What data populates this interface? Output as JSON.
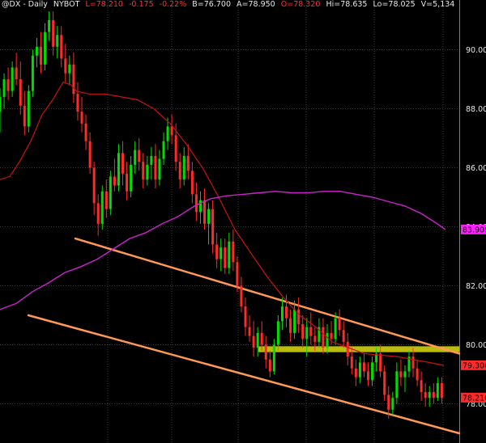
{
  "header": {
    "symbol": "@DX - Daily",
    "exchange": "NYBOT",
    "last": "L=78.210",
    "change": "-0.175",
    "change_pct": "-0.22%",
    "bid": "B=76.700",
    "ask": "A=78.950",
    "open": "O=78.320",
    "high": "Hi=78.635",
    "low": "Lo=78.025",
    "volume": "V=5,134"
  },
  "colors": {
    "background": "#000000",
    "grid": "#3a3a3a",
    "up_candle": "#00dd00",
    "down_candle": "#ff2a2a",
    "ma_short": "#cc1111",
    "ma_long": "#cc22cc",
    "channel": "#ff9955",
    "zone": "#dddd11",
    "header_red": "#ff3030",
    "tag_magenta": "#ff22ff",
    "tag_red": "#ff2a2a"
  },
  "chart_data": {
    "type": "candlestick",
    "title": "@DX - Daily",
    "ylim": [
      77.0,
      91.6
    ],
    "y_ticks": [
      "90.000",
      "88.000",
      "86.000",
      "84.000",
      "82.000",
      "80.000",
      "78.000"
    ],
    "y_tick_values": [
      90,
      88,
      86,
      84,
      82,
      80,
      78
    ],
    "grid": true,
    "price_tags": [
      {
        "label": "83.909",
        "value": 83.909,
        "color": "magenta"
      },
      {
        "label": "79.306",
        "value": 79.306,
        "color": "red"
      },
      {
        "label": "78.210",
        "value": 78.21,
        "color": "red"
      }
    ],
    "candles": [
      [
        87.9,
        88.7,
        87.2,
        88.4
      ],
      [
        88.4,
        89.2,
        88.0,
        89.0
      ],
      [
        89.0,
        89.4,
        88.3,
        88.6
      ],
      [
        88.6,
        89.6,
        88.4,
        89.4
      ],
      [
        89.4,
        89.9,
        88.8,
        89.0
      ],
      [
        89.0,
        89.6,
        87.8,
        88.1
      ],
      [
        88.1,
        88.6,
        87.1,
        87.4
      ],
      [
        87.4,
        88.8,
        87.2,
        88.6
      ],
      [
        88.6,
        90.0,
        88.4,
        89.8
      ],
      [
        89.8,
        90.4,
        89.4,
        90.1
      ],
      [
        90.1,
        90.6,
        89.2,
        89.5
      ],
      [
        89.5,
        90.9,
        89.3,
        90.6
      ],
      [
        90.6,
        91.3,
        90.3,
        91.0
      ],
      [
        91.0,
        91.3,
        89.8,
        90.1
      ],
      [
        90.1,
        90.8,
        89.7,
        90.5
      ],
      [
        90.5,
        90.8,
        89.4,
        89.7
      ],
      [
        89.7,
        90.2,
        88.9,
        89.2
      ],
      [
        89.2,
        89.8,
        88.8,
        89.5
      ],
      [
        89.5,
        89.9,
        88.2,
        88.5
      ],
      [
        88.5,
        88.9,
        87.6,
        87.9
      ],
      [
        87.9,
        88.4,
        87.2,
        87.5
      ],
      [
        87.5,
        87.8,
        86.6,
        86.9
      ],
      [
        86.9,
        87.2,
        85.8,
        86.0
      ],
      [
        86.0,
        86.2,
        84.4,
        84.8
      ],
      [
        84.8,
        85.1,
        83.7,
        84.1
      ],
      [
        84.1,
        85.4,
        83.9,
        85.2
      ],
      [
        85.2,
        85.6,
        84.3,
        84.6
      ],
      [
        84.6,
        85.9,
        84.4,
        85.7
      ],
      [
        85.7,
        86.3,
        85.2,
        85.4
      ],
      [
        85.4,
        86.8,
        85.2,
        86.5
      ],
      [
        86.5,
        86.9,
        85.4,
        85.8
      ],
      [
        85.8,
        86.2,
        84.9,
        85.2
      ],
      [
        85.2,
        86.4,
        85.0,
        86.1
      ],
      [
        86.1,
        86.9,
        85.8,
        86.6
      ],
      [
        86.6,
        87.0,
        85.9,
        86.2
      ],
      [
        86.2,
        86.5,
        85.3,
        85.6
      ],
      [
        85.6,
        86.4,
        85.4,
        86.1
      ],
      [
        86.1,
        86.7,
        85.6,
        86.4
      ],
      [
        86.4,
        86.8,
        85.3,
        85.6
      ],
      [
        85.6,
        86.6,
        85.4,
        86.3
      ],
      [
        86.3,
        87.2,
        86.1,
        86.9
      ],
      [
        86.9,
        87.7,
        86.6,
        87.4
      ],
      [
        87.4,
        87.8,
        86.8,
        87.1
      ],
      [
        87.1,
        87.5,
        85.9,
        86.2
      ],
      [
        86.2,
        86.5,
        85.3,
        85.6
      ],
      [
        85.6,
        86.7,
        85.4,
        86.4
      ],
      [
        86.4,
        86.8,
        85.6,
        85.9
      ],
      [
        85.9,
        86.2,
        84.8,
        85.1
      ],
      [
        85.1,
        85.5,
        84.2,
        84.5
      ],
      [
        84.5,
        85.2,
        84.1,
        84.9
      ],
      [
        84.9,
        85.3,
        83.9,
        84.1
      ],
      [
        84.1,
        84.8,
        83.4,
        84.6
      ],
      [
        84.6,
        84.9,
        83.1,
        83.4
      ],
      [
        83.4,
        83.8,
        82.6,
        82.9
      ],
      [
        82.9,
        83.6,
        82.5,
        83.3
      ],
      [
        83.3,
        83.6,
        82.4,
        82.6
      ],
      [
        82.6,
        83.8,
        82.4,
        83.5
      ],
      [
        83.5,
        83.9,
        82.5,
        82.8
      ],
      [
        82.8,
        83.0,
        81.8,
        82.0
      ],
      [
        82.0,
        82.3,
        81.1,
        81.3
      ],
      [
        81.3,
        81.6,
        80.3,
        80.6
      ],
      [
        80.6,
        81.0,
        80.1,
        80.3
      ],
      [
        80.3,
        80.8,
        79.6,
        79.9
      ],
      [
        79.9,
        80.6,
        79.6,
        80.4
      ],
      [
        80.4,
        80.8,
        79.8,
        80.0
      ],
      [
        80.0,
        80.3,
        79.2,
        79.5
      ],
      [
        79.5,
        79.8,
        78.9,
        79.1
      ],
      [
        79.1,
        80.2,
        79.0,
        80.0
      ],
      [
        80.0,
        81.0,
        79.8,
        80.8
      ],
      [
        80.8,
        81.6,
        80.5,
        81.3
      ],
      [
        81.3,
        81.7,
        80.6,
        80.9
      ],
      [
        80.9,
        81.2,
        80.1,
        80.4
      ],
      [
        80.4,
        81.5,
        80.2,
        81.2
      ],
      [
        81.2,
        81.6,
        80.4,
        80.7
      ],
      [
        80.7,
        81.0,
        79.9,
        80.2
      ],
      [
        80.2,
        80.9,
        79.6,
        80.6
      ],
      [
        80.6,
        81.1,
        80.0,
        80.3
      ],
      [
        80.3,
        80.6,
        79.8,
        80.1
      ],
      [
        80.1,
        80.9,
        79.9,
        80.6
      ],
      [
        80.6,
        80.9,
        79.7,
        79.9
      ],
      [
        79.9,
        80.7,
        79.7,
        80.4
      ],
      [
        80.4,
        80.8,
        80.0,
        80.2
      ],
      [
        80.2,
        81.1,
        80.0,
        80.9
      ],
      [
        80.9,
        81.2,
        80.3,
        80.5
      ],
      [
        80.5,
        80.8,
        79.9,
        80.1
      ],
      [
        80.1,
        80.4,
        79.3,
        79.6
      ],
      [
        79.6,
        79.9,
        79.0,
        79.2
      ],
      [
        79.2,
        79.5,
        78.6,
        78.9
      ],
      [
        78.9,
        79.6,
        78.7,
        79.4
      ],
      [
        79.4,
        79.7,
        78.9,
        79.1
      ],
      [
        79.1,
        79.4,
        78.6,
        78.8
      ],
      [
        78.8,
        79.6,
        78.6,
        79.4
      ],
      [
        79.4,
        79.9,
        79.1,
        79.7
      ],
      [
        79.7,
        80.0,
        78.9,
        79.1
      ],
      [
        79.1,
        79.3,
        78.1,
        78.3
      ],
      [
        78.3,
        78.6,
        77.5,
        77.8
      ],
      [
        77.8,
        78.4,
        77.6,
        78.2
      ],
      [
        78.2,
        79.4,
        78.0,
        79.1
      ],
      [
        79.1,
        79.5,
        78.6,
        78.9
      ],
      [
        78.9,
        79.3,
        78.4,
        79.1
      ],
      [
        79.1,
        79.8,
        78.9,
        79.6
      ],
      [
        79.6,
        79.9,
        78.9,
        79.2
      ],
      [
        79.2,
        79.5,
        78.6,
        78.8
      ],
      [
        78.8,
        79.1,
        78.1,
        78.4
      ],
      [
        78.4,
        78.7,
        77.9,
        78.2
      ],
      [
        78.2,
        78.6,
        77.9,
        78.4
      ],
      [
        78.4,
        78.7,
        78.0,
        78.2
      ],
      [
        78.2,
        78.9,
        78.1,
        78.7
      ],
      [
        78.7,
        78.9,
        78.0,
        78.2
      ]
    ],
    "ma_short": [
      [
        0,
        85.6
      ],
      [
        12,
        85.7
      ],
      [
        24,
        86.2
      ],
      [
        38,
        86.9
      ],
      [
        52,
        87.8
      ],
      [
        65,
        88.3
      ],
      [
        78,
        88.9
      ],
      [
        88,
        88.8
      ],
      [
        94,
        88.6
      ],
      [
        110,
        88.5
      ],
      [
        130,
        88.5
      ],
      [
        150,
        88.4
      ],
      [
        170,
        88.3
      ],
      [
        190,
        88.0
      ],
      [
        210,
        87.5
      ],
      [
        230,
        86.8
      ],
      [
        250,
        86.0
      ],
      [
        270,
        85.0
      ],
      [
        290,
        83.9
      ],
      [
        310,
        83.1
      ],
      [
        330,
        82.3
      ],
      [
        350,
        81.6
      ],
      [
        370,
        81.0
      ],
      [
        390,
        80.6
      ],
      [
        410,
        80.1
      ],
      [
        430,
        79.9
      ],
      [
        450,
        79.7
      ],
      [
        470,
        79.65
      ],
      [
        490,
        79.6
      ],
      [
        510,
        79.5
      ],
      [
        530,
        79.4
      ],
      [
        548,
        79.3
      ]
    ],
    "ma_long": [
      [
        0,
        81.2
      ],
      [
        20,
        81.4
      ],
      [
        40,
        81.8
      ],
      [
        60,
        82.1
      ],
      [
        80,
        82.45
      ],
      [
        100,
        82.65
      ],
      [
        120,
        82.9
      ],
      [
        140,
        83.25
      ],
      [
        160,
        83.6
      ],
      [
        180,
        83.8
      ],
      [
        200,
        84.1
      ],
      [
        220,
        84.35
      ],
      [
        240,
        84.7
      ],
      [
        260,
        84.95
      ],
      [
        280,
        85.05
      ],
      [
        300,
        85.1
      ],
      [
        320,
        85.15
      ],
      [
        340,
        85.2
      ],
      [
        360,
        85.15
      ],
      [
        380,
        85.15
      ],
      [
        400,
        85.2
      ],
      [
        420,
        85.2
      ],
      [
        440,
        85.1
      ],
      [
        460,
        85.0
      ],
      [
        480,
        84.85
      ],
      [
        500,
        84.7
      ],
      [
        520,
        84.45
      ],
      [
        540,
        84.1
      ],
      [
        550,
        83.9
      ]
    ],
    "channel_upper": [
      [
        93,
        83.6
      ],
      [
        567,
        79.7
      ]
    ],
    "channel_lower": [
      [
        35,
        81.0
      ],
      [
        567,
        77.0
      ]
    ],
    "zone": [
      [
        319,
        567
      ],
      [
        79.75,
        79.95
      ]
    ]
  }
}
